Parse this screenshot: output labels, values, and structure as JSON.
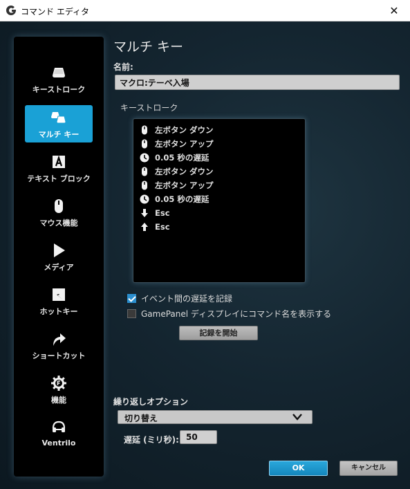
{
  "window": {
    "title": "コマンド エディタ",
    "close_glyph": "✕"
  },
  "sidebar": {
    "items": [
      {
        "label": "キーストローク",
        "icon": "keycap-icon",
        "active": false
      },
      {
        "label": "マルチ キー",
        "icon": "multi-key-icon",
        "active": true
      },
      {
        "label": "テキスト ブロック",
        "icon": "text-block-icon",
        "active": false
      },
      {
        "label": "マウス機能",
        "icon": "mouse-icon",
        "active": false
      },
      {
        "label": "メディア",
        "icon": "play-icon",
        "active": false
      },
      {
        "label": "ホットキー",
        "icon": "hotkey-icon",
        "active": false
      },
      {
        "label": "ショートカット",
        "icon": "shortcut-arrow-icon",
        "active": false
      },
      {
        "label": "機能",
        "icon": "function-gear-icon",
        "active": false
      },
      {
        "label": "Ventrilo",
        "icon": "headset-icon",
        "active": false
      }
    ]
  },
  "main": {
    "title": "マルチ キー",
    "name_label": "名前:",
    "name_value": "マクロ:テーベ入場",
    "keystroke_label": "キーストローク",
    "keystrokes": [
      {
        "icon": "mouse-icon",
        "text": "左ボタン ダウン"
      },
      {
        "icon": "mouse-icon",
        "text": "左ボタン アップ"
      },
      {
        "icon": "clock-icon",
        "text": "0.05 秒の遅延"
      },
      {
        "icon": "mouse-icon",
        "text": "左ボタン ダウン"
      },
      {
        "icon": "mouse-icon",
        "text": "左ボタン アップ"
      },
      {
        "icon": "clock-icon",
        "text": "0.05 秒の遅延"
      },
      {
        "icon": "arrow-down-icon",
        "text": "Esc"
      },
      {
        "icon": "arrow-up-icon",
        "text": "Esc"
      }
    ],
    "record_delay_label": "イベント間の遅延を記録",
    "record_delay_checked": true,
    "gamepanel_label": "GamePanel ディスプレイにコマンド名を表示する",
    "gamepanel_checked": false,
    "record_button": "記録を開始",
    "repeat_label": "繰り返しオプション",
    "repeat_value": "切り替え",
    "delay_label": "遅延 (ミリ秒):",
    "delay_value": "50",
    "ok_button": "OK",
    "cancel_button": "キャンセル"
  },
  "colors": {
    "accent": "#1aa1d6",
    "background": "#142530"
  }
}
